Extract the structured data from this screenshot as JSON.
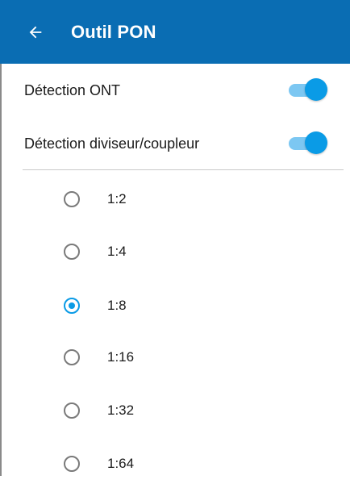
{
  "app_bar": {
    "title": "Outil PON",
    "background": "#0a6db3",
    "back_icon": "arrow-left-icon"
  },
  "toggles": [
    {
      "label": "Détection ONT",
      "enabled": true
    },
    {
      "label": "Détection diviseur/coupleur",
      "enabled": true
    }
  ],
  "accent_color": "#0a9be6",
  "split_ratios": {
    "selected": "1:8",
    "options": [
      {
        "label": "1:2"
      },
      {
        "label": "1:4"
      },
      {
        "label": "1:8"
      },
      {
        "label": "1:16"
      },
      {
        "label": "1:32"
      },
      {
        "label": "1:64"
      }
    ]
  }
}
